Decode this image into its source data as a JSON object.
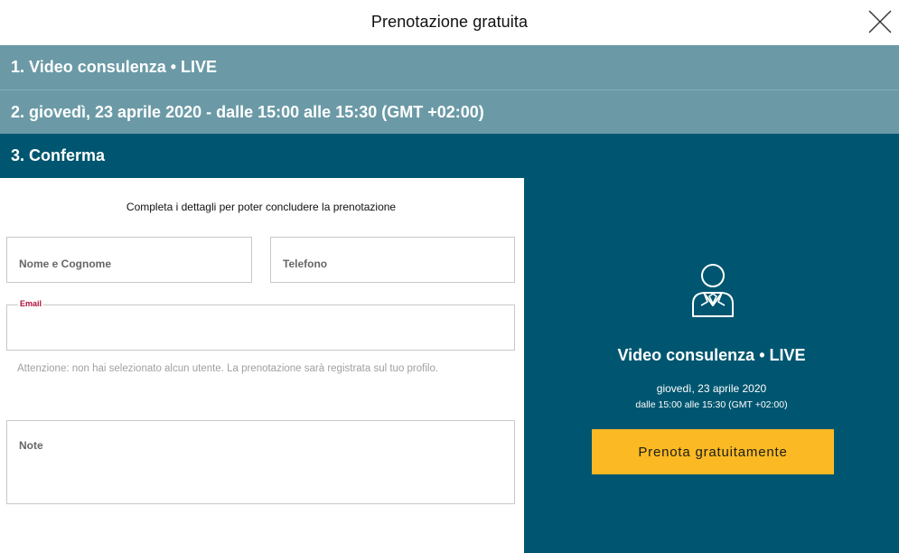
{
  "header": {
    "title": "Prenotazione gratuita",
    "close_icon": "close-icon"
  },
  "steps": [
    {
      "label": "1. Video consulenza • LIVE",
      "state": "completed"
    },
    {
      "label": "2. giovedì, 23 aprile 2020 - dalle 15:00 alle 15:30 (GMT +02:00)",
      "state": "completed"
    },
    {
      "label": "3. Conferma",
      "state": "active"
    }
  ],
  "form": {
    "intro": "Completa i dettagli per poter concludere la prenotazione",
    "name": {
      "placeholder": "Nome e Cognome",
      "value": ""
    },
    "phone": {
      "placeholder": "Telefono",
      "value": ""
    },
    "email": {
      "label": "Email",
      "value": ""
    },
    "warning": "Attenzione: non hai selezionato alcun utente. La prenotazione sarà registrata sul tuo profilo.",
    "note": {
      "placeholder": "Note",
      "value": ""
    }
  },
  "summary": {
    "icon": "consultant-icon",
    "title": "Video consulenza • LIVE",
    "date": "giovedì, 23 aprile 2020",
    "time": "dalle 15:00 alle 15:30 (GMT +02:00)",
    "book_label": "Prenota gratuitamente"
  },
  "colors": {
    "step_completed": "#6b9aa6",
    "step_active": "#005670",
    "panel": "#005670",
    "button": "#fbb923",
    "email_label": "#b0103a"
  }
}
